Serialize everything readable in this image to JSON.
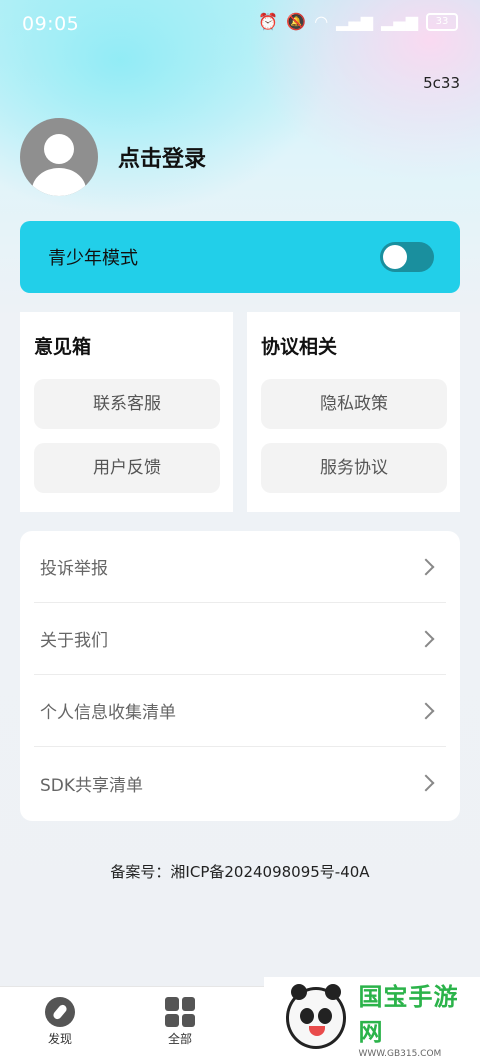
{
  "status_bar": {
    "time": "09:05",
    "icons": [
      "alarm-icon",
      "mute-icon",
      "wifi-icon",
      "signal-icon",
      "signal-icon"
    ],
    "battery": "33"
  },
  "version": "5c33",
  "profile": {
    "login_label": "点击登录"
  },
  "teen_mode": {
    "label": "青少年模式",
    "enabled": false
  },
  "feedback_box": {
    "title": "意见箱",
    "buttons": [
      "联系客服",
      "用户反馈"
    ]
  },
  "agreement_box": {
    "title": "协议相关",
    "buttons": [
      "隐私政策",
      "服务协议"
    ]
  },
  "menu": {
    "items": [
      {
        "label": "投诉举报"
      },
      {
        "label": "关于我们"
      },
      {
        "label": "个人信息收集清单"
      },
      {
        "label": "SDK共享清单"
      }
    ]
  },
  "icp": "备案号：湘ICP备2024098095号-40A",
  "bottom_nav": {
    "items": [
      {
        "label": "发现",
        "icon": "compass-icon"
      },
      {
        "label": "全部",
        "icon": "grid-icon"
      }
    ]
  },
  "watermark": {
    "name": "国宝手游网",
    "url": "WWW.GB315.COM"
  },
  "colors": {
    "accent": "#22cfe9",
    "toggle_track": "#1a8f9e",
    "watermark_green": "#2bb34a"
  }
}
